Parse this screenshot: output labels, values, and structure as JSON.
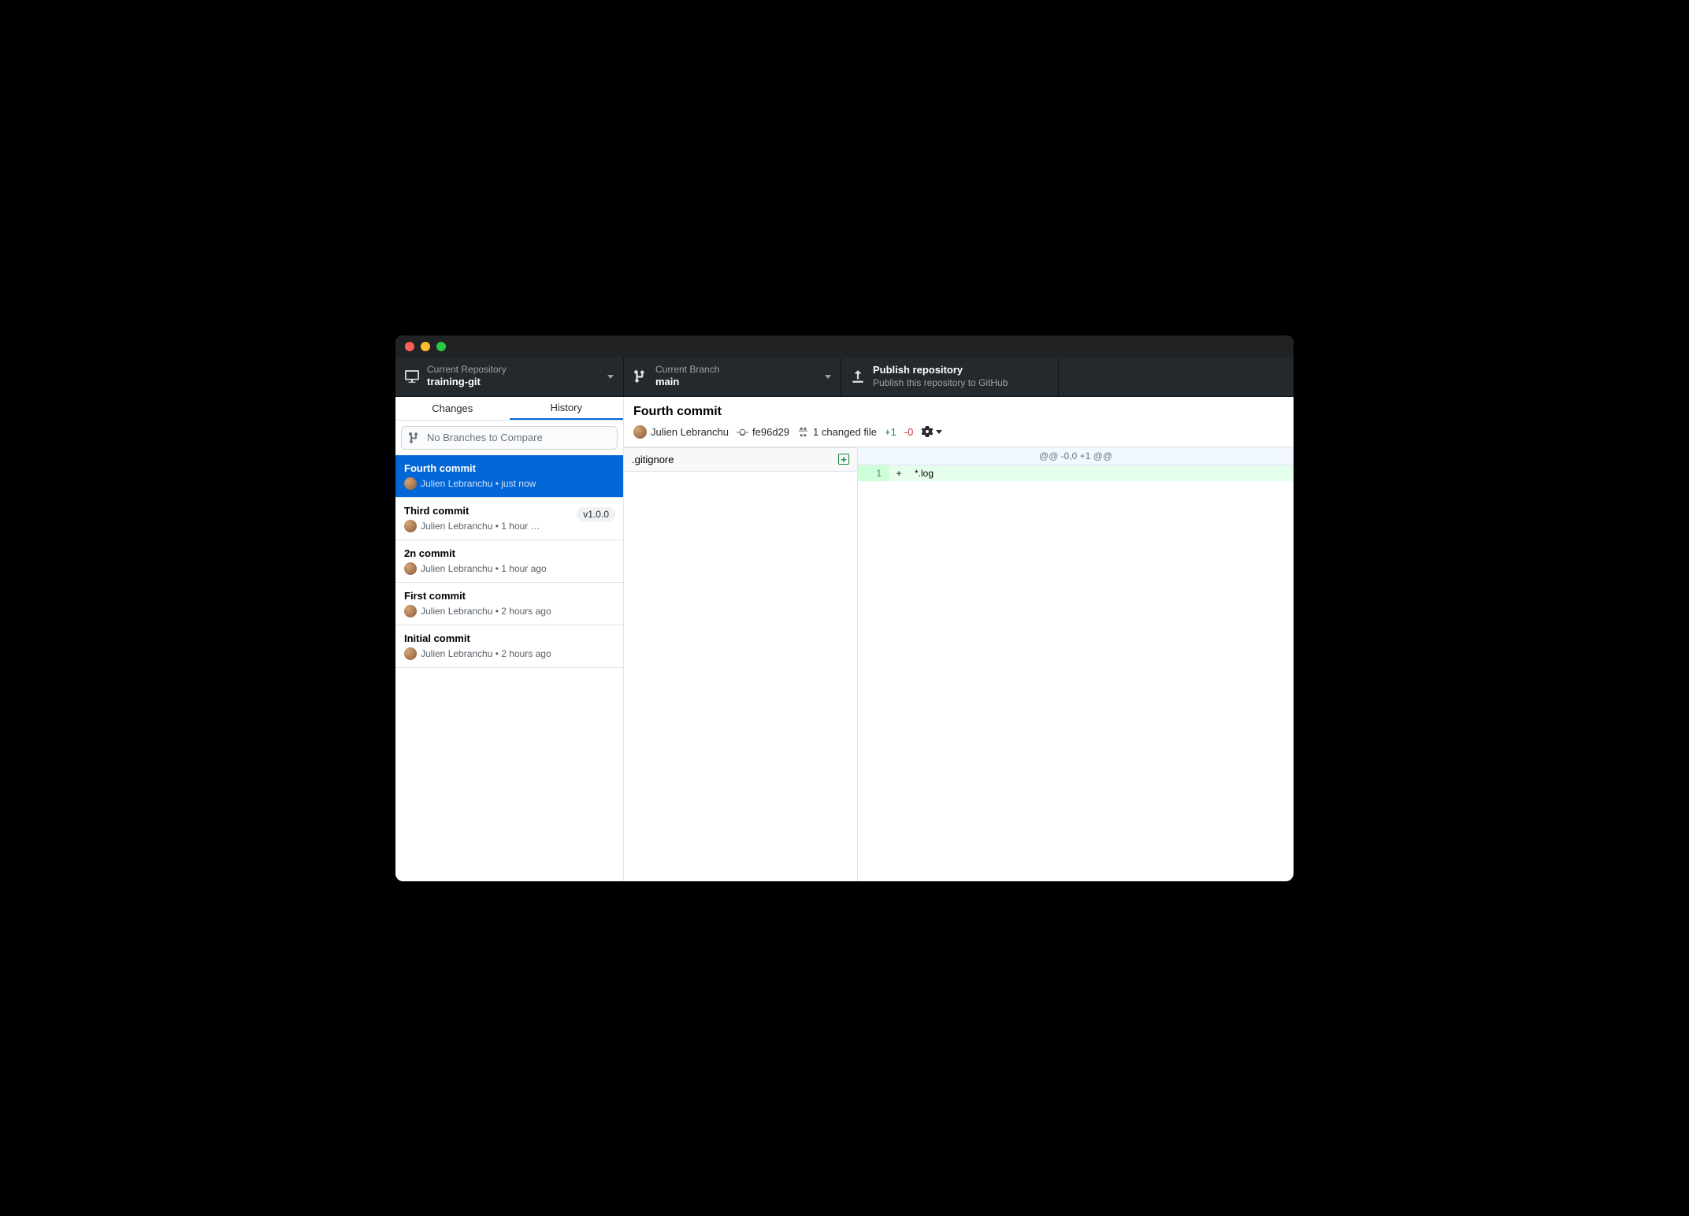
{
  "toolbar": {
    "repo": {
      "label": "Current Repository",
      "value": "training-git"
    },
    "branch": {
      "label": "Current Branch",
      "value": "main"
    },
    "publish": {
      "label": "Publish repository",
      "value": "Publish this repository to GitHub"
    }
  },
  "tabs": {
    "changes": "Changes",
    "history": "History"
  },
  "compare_text": "No Branches to Compare",
  "commits": [
    {
      "title": "Fourth commit",
      "author": "Julien Lebranchu",
      "time": "just now",
      "tag": "",
      "selected": true
    },
    {
      "title": "Third commit",
      "author": "Julien Lebranchu",
      "time": "1 hour …",
      "tag": "v1.0.0",
      "selected": false
    },
    {
      "title": "2n commit",
      "author": "Julien Lebranchu",
      "time": "1 hour ago",
      "tag": "",
      "selected": false
    },
    {
      "title": "First commit",
      "author": "Julien Lebranchu",
      "time": "2 hours ago",
      "tag": "",
      "selected": false
    },
    {
      "title": "Initial commit",
      "author": "Julien Lebranchu",
      "time": "2 hours ago",
      "tag": "",
      "selected": false
    }
  ],
  "detail": {
    "title": "Fourth commit",
    "author": "Julien Lebranchu",
    "sha": "fe96d29",
    "changed_files": "1 changed file",
    "additions": "+1",
    "deletions": "-0",
    "file": ".gitignore",
    "hunk": "@@ -0,0 +1 @@",
    "line_no": "1",
    "line_sign": "+",
    "line_content": "*.log"
  }
}
